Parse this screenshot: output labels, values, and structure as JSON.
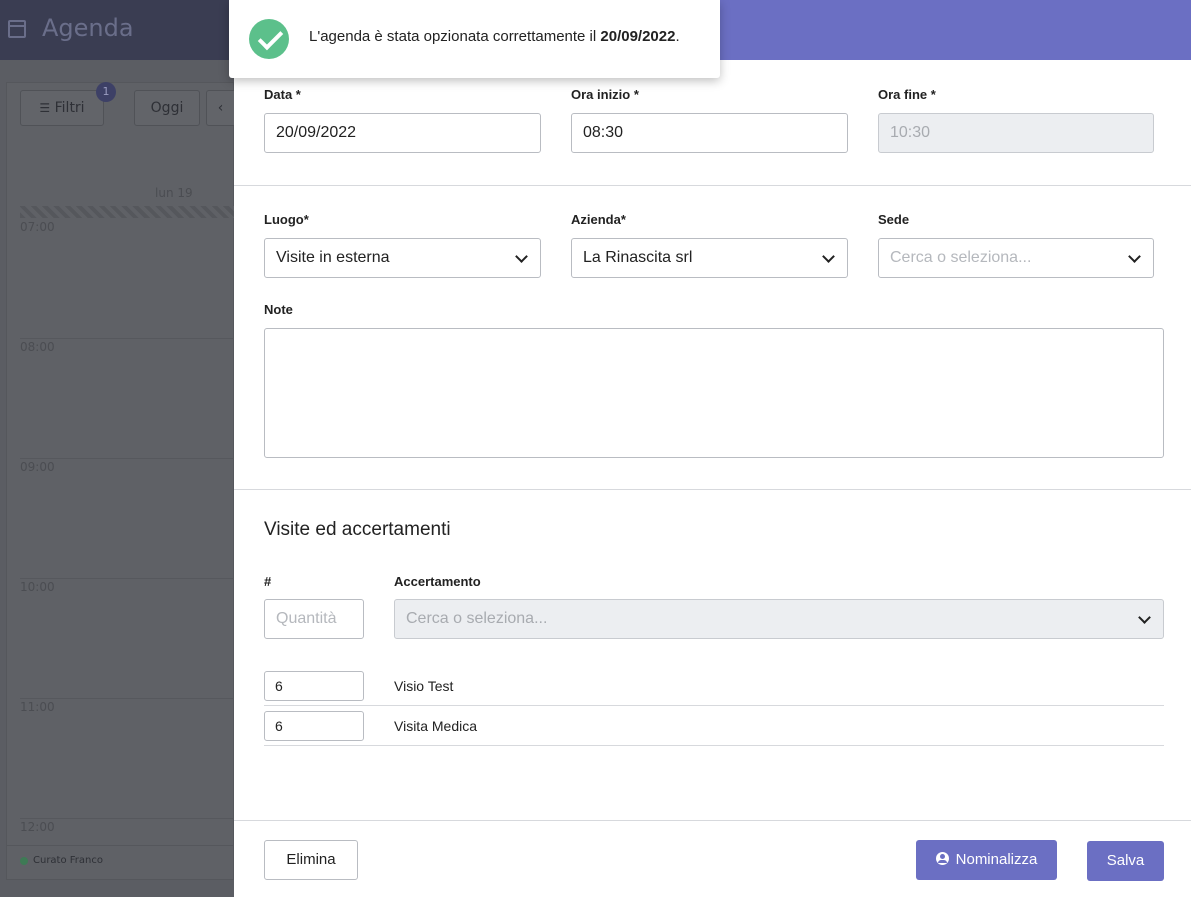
{
  "background": {
    "title": "Agenda",
    "filters_label": "Filtri",
    "filters_badge": "1",
    "today_label": "Oggi",
    "prev_icon": "chevron-left-icon",
    "day_label": "lun 19",
    "times": [
      "07:00",
      "08:00",
      "09:00",
      "10:00",
      "11:00",
      "12:00"
    ],
    "user_name": "Curato Franco"
  },
  "toast": {
    "message_prefix": "L'agenda è stata opzionata correttamente il ",
    "message_date": "20/09/2022",
    "message_suffix": ".",
    "icon": "check-circle-icon"
  },
  "form": {
    "date": {
      "label": "Data *",
      "value": "20/09/2022"
    },
    "start_time": {
      "label": "Ora inizio *",
      "value": "08:30"
    },
    "end_time": {
      "label": "Ora fine *",
      "value": "10:30"
    },
    "place": {
      "label": "Luogo*",
      "value": "Visite in esterna"
    },
    "company": {
      "label": "Azienda*",
      "value": "La Rinascita srl"
    },
    "site": {
      "label": "Sede",
      "placeholder": "Cerca o seleziona..."
    },
    "notes": {
      "label": "Note",
      "value": ""
    }
  },
  "visits": {
    "title": "Visite ed accertamenti",
    "qty_header": "#",
    "exam_header": "Accertamento",
    "qty_placeholder": "Quantità",
    "exam_placeholder": "Cerca o seleziona...",
    "rows": [
      {
        "qty": "6",
        "name": "Visio Test"
      },
      {
        "qty": "6",
        "name": "Visita Medica"
      }
    ]
  },
  "actions": {
    "delete_label": "Elimina",
    "nominalize_label": "Nominalizza",
    "save_label": "Salva"
  },
  "colors": {
    "primary": "#6b6fc3",
    "success": "#5cc08b"
  }
}
